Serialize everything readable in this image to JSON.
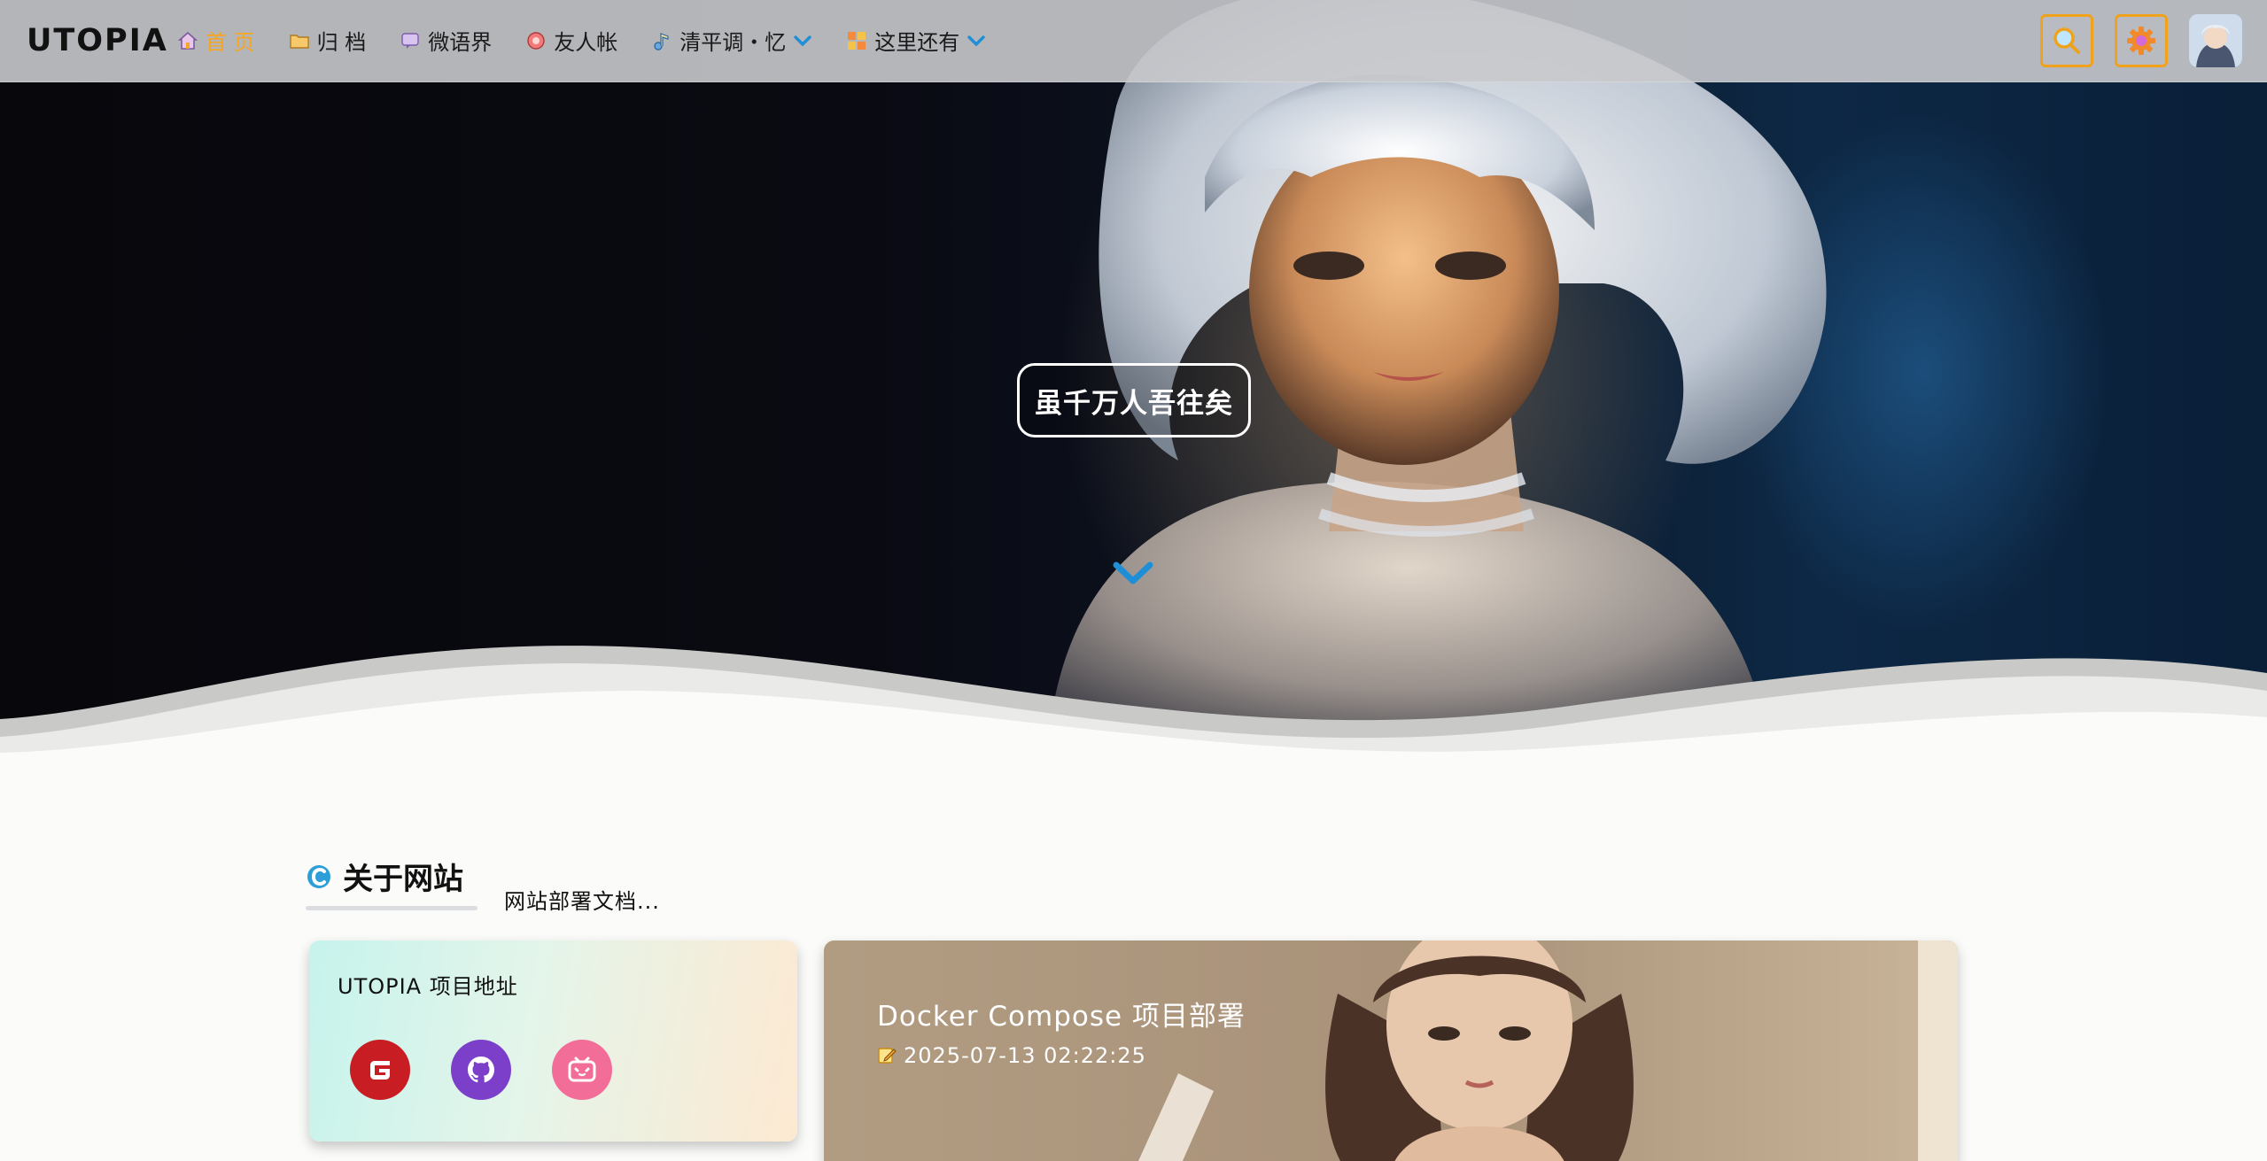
{
  "navbar": {
    "brand": "UTOPIA",
    "items": [
      {
        "label": "首 页",
        "icon": "home-icon",
        "active": true
      },
      {
        "label": "归 档",
        "icon": "folder-icon"
      },
      {
        "label": "微语界",
        "icon": "chat-icon"
      },
      {
        "label": "友人帐",
        "icon": "friends-icon"
      },
      {
        "label": "清平调・忆",
        "icon": "music-icon",
        "dropdown": true
      },
      {
        "label": "这里还有",
        "icon": "grid-icon",
        "dropdown": true
      }
    ],
    "actions": {
      "search": "search-icon",
      "settings": "gear-icon",
      "avatar": "avatar"
    },
    "accent_color": "#f0a21b"
  },
  "hero": {
    "tagline": "虽千万人吾往矣",
    "scroll_indicator": "chevron-down-icon",
    "chevron_color": "#1e8fd6"
  },
  "about": {
    "title": "关于网站",
    "subtitle": "网站部署文档..."
  },
  "project_card": {
    "title": "UTOPIA 项目地址",
    "links": [
      {
        "name": "gitee-icon",
        "color": "#c71d23"
      },
      {
        "name": "github-icon",
        "color": "#7b3fc9"
      },
      {
        "name": "bilibili-icon",
        "color": "#f26d98"
      }
    ]
  },
  "post_card": {
    "title": "Docker Compose 项目部署",
    "date": "2025-07-13 02:22:25"
  }
}
